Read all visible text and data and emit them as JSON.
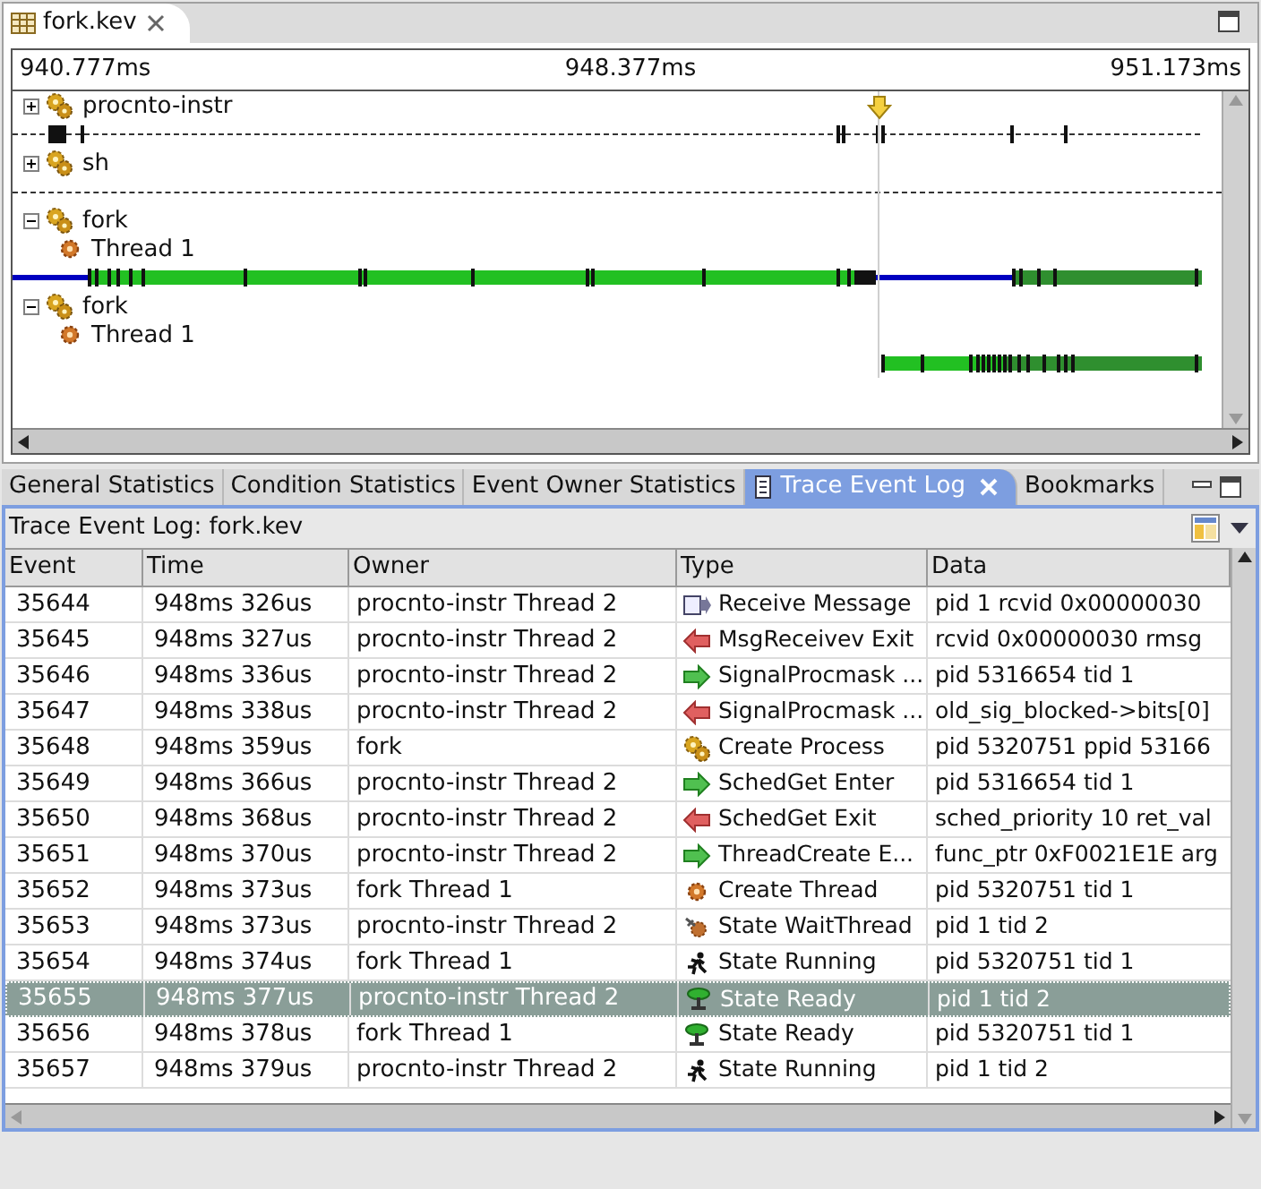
{
  "editor": {
    "tab": {
      "label": "fork.kev",
      "selected": true
    }
  },
  "timeline": {
    "time_labels": [
      "940.777ms",
      "948.377ms",
      "951.173ms"
    ],
    "tree": [
      {
        "label": "procnto-instr",
        "expanded": false
      },
      {
        "label": "sh",
        "expanded": false
      },
      {
        "label": "fork",
        "expanded": true,
        "children": [
          {
            "label": "Thread 1"
          }
        ]
      },
      {
        "label": "fork",
        "expanded": true,
        "children": [
          {
            "label": "Thread 1"
          }
        ]
      }
    ]
  },
  "view": {
    "tabs": [
      {
        "label": "General Statistics",
        "selected": false
      },
      {
        "label": "Condition Statistics",
        "selected": false
      },
      {
        "label": "Event Owner Statistics",
        "selected": false
      },
      {
        "label": "Trace Event Log",
        "selected": true
      },
      {
        "label": "Bookmarks",
        "selected": false
      }
    ],
    "title": "Trace Event Log: fork.kev",
    "table": {
      "columns": [
        "Event",
        "Time",
        "Owner",
        "Type",
        "Data"
      ],
      "rows": [
        {
          "event": "35644",
          "time": "948ms 326us",
          "owner": "procnto-instr Thread 2",
          "kind": "message",
          "type": "Receive Message",
          "data": "pid 1 rcvid 0x00000030",
          "selected": false
        },
        {
          "event": "35645",
          "time": "948ms 327us",
          "owner": "procnto-instr Thread 2",
          "kind": "exit",
          "type": "MsgReceivev Exit",
          "data": "rcvid 0x00000030 rmsg",
          "selected": false
        },
        {
          "event": "35646",
          "time": "948ms 336us",
          "owner": "procnto-instr Thread 2",
          "kind": "enter",
          "type": "SignalProcmask ...",
          "data": "pid 5316654 tid 1",
          "selected": false
        },
        {
          "event": "35647",
          "time": "948ms 338us",
          "owner": "procnto-instr Thread 2",
          "kind": "exit",
          "type": "SignalProcmask ...",
          "data": "old_sig_blocked->bits[0]",
          "selected": false
        },
        {
          "event": "35648",
          "time": "948ms 359us",
          "owner": "fork",
          "kind": "process",
          "type": "Create Process",
          "data": "pid 5320751 ppid 53166",
          "selected": false
        },
        {
          "event": "35649",
          "time": "948ms 366us",
          "owner": "procnto-instr Thread 2",
          "kind": "enter",
          "type": "SchedGet Enter",
          "data": "pid 5316654 tid 1",
          "selected": false
        },
        {
          "event": "35650",
          "time": "948ms 368us",
          "owner": "procnto-instr Thread 2",
          "kind": "exit",
          "type": "SchedGet Exit",
          "data": "sched_priority 10 ret_val",
          "selected": false
        },
        {
          "event": "35651",
          "time": "948ms 370us",
          "owner": "procnto-instr Thread 2",
          "kind": "enter",
          "type": "ThreadCreate E...",
          "data": "func_ptr 0xF0021E1E arg",
          "selected": false
        },
        {
          "event": "35652",
          "time": "948ms 373us",
          "owner": "fork Thread 1",
          "kind": "thread",
          "type": "Create Thread",
          "data": "pid 5320751 tid 1",
          "selected": false
        },
        {
          "event": "35653",
          "time": "948ms 373us",
          "owner": "procnto-instr Thread 2",
          "kind": "wait",
          "type": "State WaitThread",
          "data": "pid 1 tid 2",
          "selected": false
        },
        {
          "event": "35654",
          "time": "948ms 374us",
          "owner": "fork Thread 1",
          "kind": "running",
          "type": "State Running",
          "data": "pid 5320751 tid 1",
          "selected": false
        },
        {
          "event": "35655",
          "time": "948ms 377us",
          "owner": "procnto-instr Thread 2",
          "kind": "ready",
          "type": "State Ready",
          "data": "pid 1 tid 2",
          "selected": true
        },
        {
          "event": "35656",
          "time": "948ms 378us",
          "owner": "fork Thread 1",
          "kind": "ready",
          "type": "State Ready",
          "data": "pid 5320751 tid 1",
          "selected": false
        },
        {
          "event": "35657",
          "time": "948ms 379us",
          "owner": "procnto-instr Thread 2",
          "kind": "running",
          "type": "State Running",
          "data": "pid 1 tid 2",
          "selected": false
        }
      ]
    }
  }
}
